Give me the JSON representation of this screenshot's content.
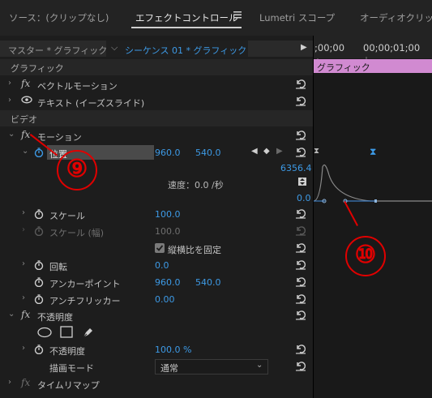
{
  "tabs": [
    "ソース：(クリップなし)",
    "エフェクトコントロール",
    "Lumetri スコープ",
    "オーディオクリップ"
  ],
  "tab_menu_icon": "hamburger-menu-icon",
  "master_label": "マスター * グラフィック",
  "sequence_label": "シーケンス 01 * グラフィック",
  "timecodes": [
    ";00;00",
    "00;00;01;00"
  ],
  "clip_label": "グラフィック",
  "sections": {
    "graphic": "グラフィック",
    "video": "ビデオ"
  },
  "effects": {
    "vector_motion": "ベクトルモーション",
    "text": "テキスト (イーズスライド)",
    "motion": "モーション",
    "opacity": "不透明度",
    "time_remap": "タイムリマップ"
  },
  "params": {
    "position": {
      "label": "位置",
      "x": "960.0",
      "y": "540.0"
    },
    "velocity": {
      "label": "速度：0.0 /秒",
      "max": "6356.4",
      "min": "0.0"
    },
    "scale": {
      "label": "スケール",
      "value": "100.0"
    },
    "scale_width": {
      "label": "スケール (幅)",
      "value": "100.0"
    },
    "uniform": {
      "label": "縦横比を固定"
    },
    "rotation": {
      "label": "回転",
      "value": "0.0"
    },
    "anchor": {
      "label": "アンカーポイント",
      "x": "960.0",
      "y": "540.0"
    },
    "flicker": {
      "label": "アンチフリッカー",
      "value": "0.00"
    },
    "opacity": {
      "label": "不透明度",
      "value": "100.0 %"
    },
    "blend": {
      "label": "描画モード",
      "value": "通常"
    }
  },
  "annotations": {
    "nine": "⑨",
    "ten": "⑩"
  },
  "colors": {
    "accent_blue": "#3d9ae6",
    "clip_pink": "#d18ad1",
    "annotation_red": "#e00000"
  }
}
